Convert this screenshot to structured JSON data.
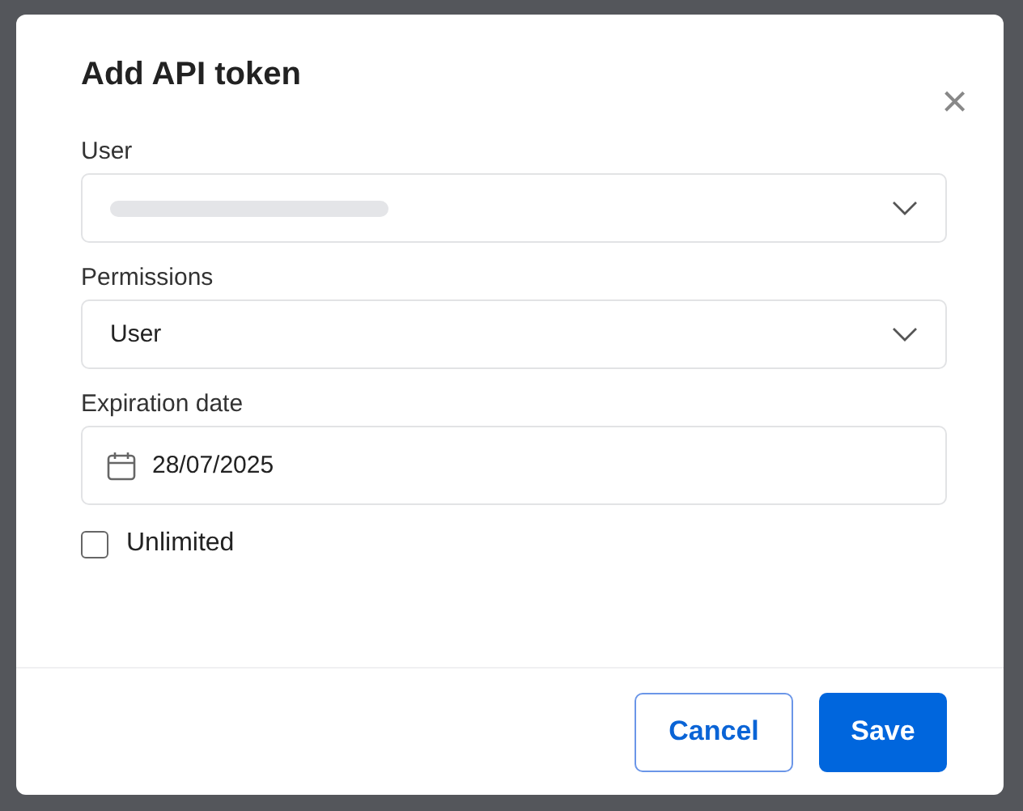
{
  "dialog": {
    "title": "Add API token",
    "close": "×"
  },
  "fields": [
    {
      "kind": "select",
      "label": "User",
      "redacted": true
    },
    {
      "kind": "select",
      "label": "Permissions",
      "value": "User"
    },
    {
      "kind": "date",
      "label": "Expiration date",
      "value": "28/07/2025"
    }
  ],
  "checkbox": {
    "label": "Unlimited",
    "checked": false
  },
  "buttons": [
    {
      "label": "Cancel",
      "kind": "secondary"
    },
    {
      "label": "Save",
      "kind": "primary"
    }
  ]
}
